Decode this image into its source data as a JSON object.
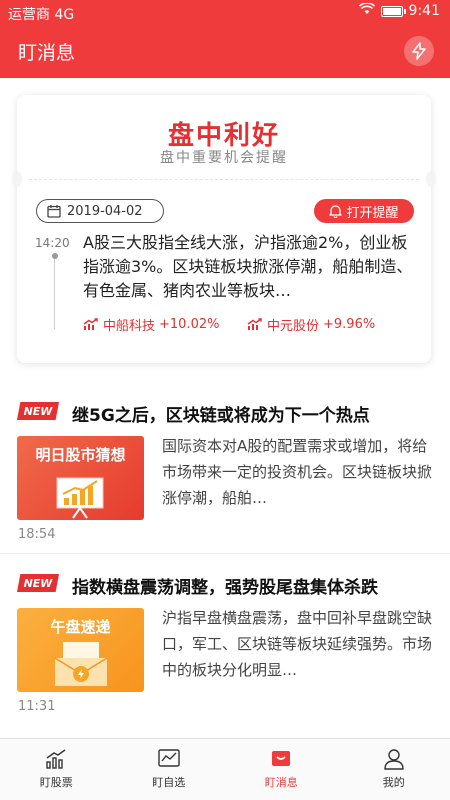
{
  "status_bar": {
    "carrier": "运营商 4G",
    "time": "9:41"
  },
  "header": {
    "title": "盯消息"
  },
  "feature": {
    "title": "盘中利好",
    "subtitle": "盘中重要机会提醒",
    "date": "2019-04-02",
    "remind_label": "打开提醒",
    "time": "14:20",
    "body": "A股三大股指全线大涨，沪指涨逾2%，创业板指涨逾3%。区块链板块掀涨停潮，船舶制造、有色金属、猪肉农业等板块…",
    "stocks": [
      {
        "name": "中船科技",
        "change": "+10.02%"
      },
      {
        "name": "中元股份",
        "change": "+9.96%"
      }
    ]
  },
  "news": [
    {
      "badge": "NEW",
      "title": "继5G之后，区块链或将成为下一个热点",
      "thumb_label": "明日股市猜想",
      "body": "国际资本对A股的配置需求或增加，将给市场带来一定的投资机会。区块链板块掀涨停潮，船舶…",
      "time": "18:54"
    },
    {
      "badge": "NEW",
      "title": "指数横盘震荡调整，强势股尾盘集体杀跌",
      "thumb_label": "午盘速递",
      "body": "沪指早盘横盘震荡，盘中回补早盘跳空缺口，军工、区块链等板块延续强势。市场中的板块分化明显…",
      "time": "11:31"
    }
  ],
  "tabbar": [
    {
      "label": "盯股票",
      "icon": "stock-chart-icon"
    },
    {
      "label": "盯自选",
      "icon": "watchlist-icon"
    },
    {
      "label": "盯消息",
      "icon": "message-icon",
      "active": true
    },
    {
      "label": "我的",
      "icon": "profile-icon"
    }
  ],
  "colors": {
    "brand": "#ef3b3b",
    "badge": "#e43030"
  }
}
